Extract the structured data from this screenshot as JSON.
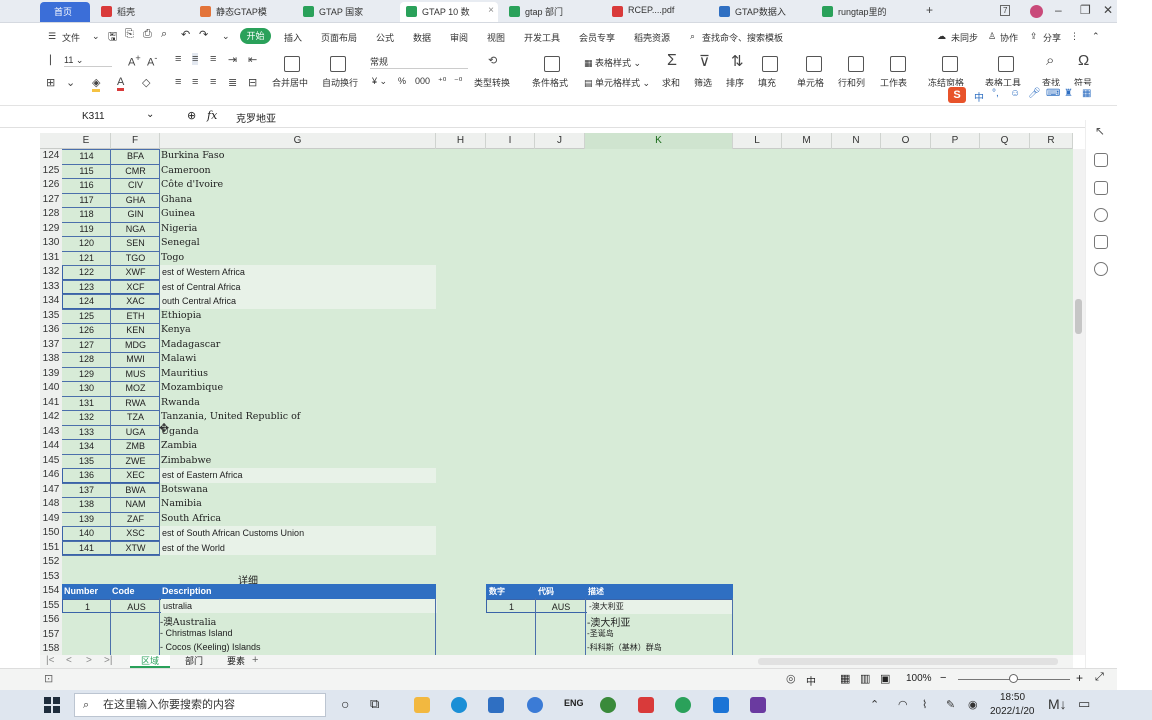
{
  "tabs": [
    {
      "label": "首页"
    },
    {
      "label": "稻壳"
    },
    {
      "label": "静态GTAP模"
    },
    {
      "label": "GTAP 国家"
    },
    {
      "label": "GTAP 10 数"
    },
    {
      "label": "gtap 部门"
    },
    {
      "label": "RCEP....pdf"
    },
    {
      "label": "GTAP数据入"
    },
    {
      "label": "rungtap里的"
    }
  ],
  "menu": {
    "file": "文件",
    "start": "开始",
    "items": [
      "插入",
      "页面布局",
      "公式",
      "数据",
      "审阅",
      "视图",
      "开发工具",
      "会员专享",
      "稻壳资源"
    ],
    "search": "查找命令、搜索模板",
    "unsynced": "未同步",
    "collab": "协作",
    "share": "分享"
  },
  "ribbon": {
    "font_size": "11",
    "number_format": "常规",
    "merge": "合并居中",
    "wrap": "自动换行",
    "type_convert": "类型转换",
    "cond_format": "条件格式",
    "table_style": "表格样式",
    "cell_style": "单元格样式",
    "sum": "求和",
    "filter": "筛选",
    "sort": "排序",
    "fill": "填充",
    "cell": "单元格",
    "row_col": "行和列",
    "worksheet": "工作表",
    "freeze": "冻结窗格",
    "table_tools": "表格工具",
    "find": "查找",
    "symbol": "符号",
    "percent": "%",
    "thousands": "000",
    "ime": "中"
  },
  "formula_bar": {
    "name_box": "K311",
    "fx": "fx",
    "content": "克罗地亚"
  },
  "columns": [
    "E",
    "F",
    "G",
    "H",
    "I",
    "J",
    "K",
    "L",
    "M",
    "N",
    "O",
    "P",
    "Q",
    "R"
  ],
  "rows": [
    {
      "r": "124",
      "e": "114",
      "f": "BFA",
      "g": "Burkina Faso",
      "boxed": false
    },
    {
      "r": "125",
      "e": "115",
      "f": "CMR",
      "g": "Cameroon",
      "boxed": false
    },
    {
      "r": "126",
      "e": "116",
      "f": "CIV",
      "g": "Côte d'Ivoire",
      "boxed": false
    },
    {
      "r": "127",
      "e": "117",
      "f": "GHA",
      "g": "Ghana",
      "boxed": false
    },
    {
      "r": "128",
      "e": "118",
      "f": "GIN",
      "g": "Guinea",
      "boxed": false
    },
    {
      "r": "129",
      "e": "119",
      "f": "NGA",
      "g": "Nigeria",
      "boxed": false
    },
    {
      "r": "130",
      "e": "120",
      "f": "SEN",
      "g": "Senegal",
      "boxed": false
    },
    {
      "r": "131",
      "e": "121",
      "f": "TGO",
      "g": "Togo",
      "boxed": false
    },
    {
      "r": "132",
      "e": "122",
      "f": "XWF",
      "g": "est of Western Africa",
      "boxed": true
    },
    {
      "r": "133",
      "e": "123",
      "f": "XCF",
      "g": "est of Central Africa",
      "boxed": true
    },
    {
      "r": "134",
      "e": "124",
      "f": "XAC",
      "g": "outh Central Africa",
      "boxed": true
    },
    {
      "r": "135",
      "e": "125",
      "f": "ETH",
      "g": "Ethiopia",
      "boxed": false
    },
    {
      "r": "136",
      "e": "126",
      "f": "KEN",
      "g": "Kenya",
      "boxed": false
    },
    {
      "r": "137",
      "e": "127",
      "f": "MDG",
      "g": "Madagascar",
      "boxed": false
    },
    {
      "r": "138",
      "e": "128",
      "f": "MWI",
      "g": "Malawi",
      "boxed": false
    },
    {
      "r": "139",
      "e": "129",
      "f": "MUS",
      "g": "Mauritius",
      "boxed": false
    },
    {
      "r": "140",
      "e": "130",
      "f": "MOZ",
      "g": "Mozambique",
      "boxed": false
    },
    {
      "r": "141",
      "e": "131",
      "f": "RWA",
      "g": "Rwanda",
      "boxed": false
    },
    {
      "r": "142",
      "e": "132",
      "f": "TZA",
      "g": "Tanzania, United Republic of",
      "boxed": false
    },
    {
      "r": "143",
      "e": "133",
      "f": "UGA",
      "g": "Uganda",
      "boxed": false
    },
    {
      "r": "144",
      "e": "134",
      "f": "ZMB",
      "g": "Zambia",
      "boxed": false
    },
    {
      "r": "145",
      "e": "135",
      "f": "ZWE",
      "g": "Zimbabwe",
      "boxed": false
    },
    {
      "r": "146",
      "e": "136",
      "f": "XEC",
      "g": "est of Eastern Africa",
      "boxed": true
    },
    {
      "r": "147",
      "e": "137",
      "f": "BWA",
      "g": "Botswana",
      "boxed": false
    },
    {
      "r": "148",
      "e": "138",
      "f": "NAM",
      "g": "Namibia",
      "boxed": false
    },
    {
      "r": "149",
      "e": "139",
      "f": "ZAF",
      "g": "South Africa",
      "boxed": false
    },
    {
      "r": "150",
      "e": "140",
      "f": "XSC",
      "g": "est of South African Customs Union",
      "boxed": true
    },
    {
      "r": "151",
      "e": "141",
      "f": "XTW",
      "g": "est of the World",
      "boxed": true
    }
  ],
  "lower": {
    "row152": "152",
    "row153": "153",
    "detail_title": "详细",
    "row154": "154",
    "hdr_en": [
      "Number",
      "Code",
      "Description"
    ],
    "hdr_cn": [
      "数字",
      "代码",
      "描述"
    ],
    "row155": "155",
    "n1": "1",
    "code1": "AUS",
    "desc1": "ustralia",
    "cn_n1": "1",
    "cn_code1": "AUS",
    "cn_desc1": "-澳大利亚",
    "row156": "156",
    "desc2": "-澳Australia",
    "cn_desc2": "-澳大利亚",
    "row157": "157",
    "desc3": "- Christmas Island",
    "cn_desc3": "-圣诞岛",
    "row158": "158",
    "desc4": "- Cocos (Keeling) Islands",
    "cn_desc4": "-科科斯（基林）群岛"
  },
  "sheets": [
    "区域",
    "部门",
    "要素"
  ],
  "status": {
    "zoom": "100%",
    "ime": "中"
  },
  "taskbar": {
    "search_placeholder": "在这里输入你要搜索的内容",
    "time": "18:50",
    "date": "2022/1/20",
    "lang": "ENG"
  },
  "colors": {
    "accent": "#2aa15a",
    "header_blue": "#2f6fc2",
    "sheet_green": "#d7ebd7"
  }
}
